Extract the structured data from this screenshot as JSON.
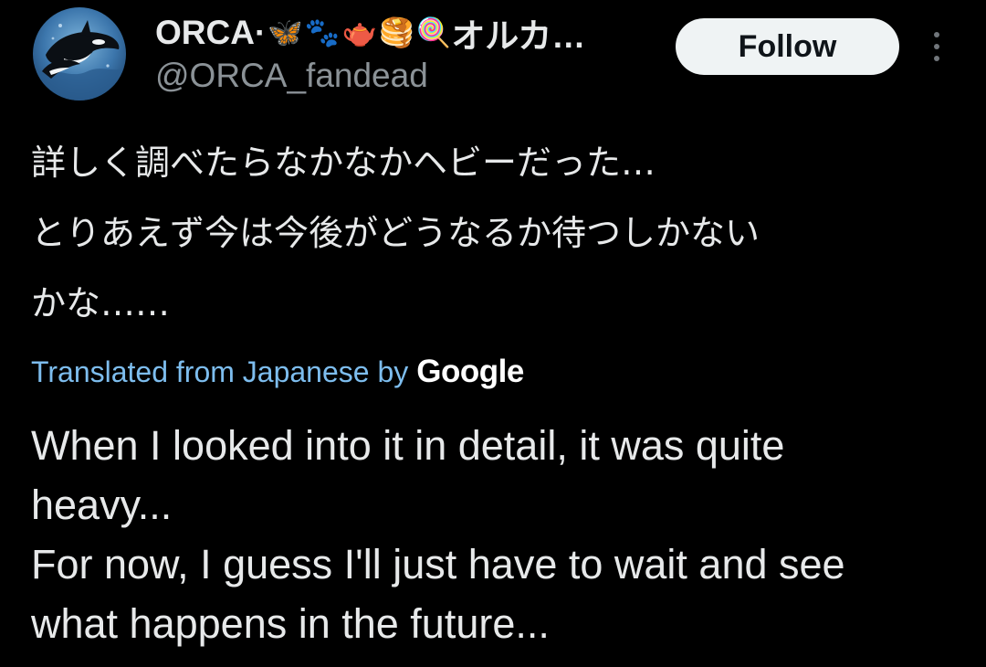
{
  "author": {
    "display_name": "ORCA·",
    "display_name_suffix": "オルカ…",
    "emojis": [
      "🦋",
      "🐾",
      "🫖",
      "🥞",
      "🍭"
    ],
    "handle": "@ORCA_fandead",
    "avatar_icon": "orca-avatar-icon"
  },
  "actions": {
    "follow_label": "Follow",
    "more_icon": "more-vertical-icon"
  },
  "post": {
    "original_lines": [
      "詳しく調べたらなかなかヘビーだった…",
      "とりあえず今は今後がどうなるか待つしかない",
      "かな……"
    ],
    "translation_credit": "Translated from Japanese by",
    "translation_provider": "Google",
    "translation_lines": [
      "When I looked into it in detail, it was quite",
      "heavy...",
      "For now, I guess I'll just have to wait and see",
      "what happens in the future..."
    ]
  },
  "colors": {
    "background": "#000000",
    "text_primary": "#e7e9ea",
    "text_secondary": "#8b9297",
    "link": "#7dbdee",
    "follow_bg": "#eff3f4"
  }
}
